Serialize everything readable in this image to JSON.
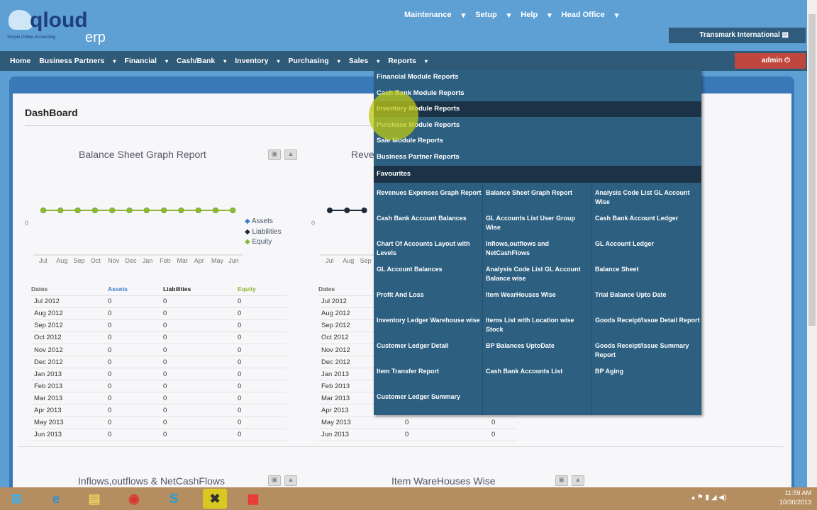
{
  "app": {
    "logo_main": "qloud",
    "logo_erp": "erp",
    "logo_tagline": "Simple Online Accounting"
  },
  "topnav": [
    "Maintenance",
    "Setup",
    "Help",
    "Head Office"
  ],
  "company": "Transmark International",
  "user": "admin",
  "mainnav": [
    "Home",
    "Business Partners",
    "Financial",
    "Cash/Bank",
    "Inventory",
    "Purchasing",
    "Sales",
    "Reports"
  ],
  "dashboard": {
    "title": "DashBoard"
  },
  "reports_menu": {
    "items": [
      "Financial Module Reports",
      "Cash Bank Module Reports",
      "Inventory Module Reports",
      "Purchase Module Reports",
      "Sale Module Reports",
      "Business Partner Reports"
    ],
    "highlighted": 2,
    "favourites_label": "Favourites",
    "favourites": [
      [
        "Revenues Expenses Graph Report",
        "Cash Bank Account Balances",
        "Chart Of Accounts Layout with Levels",
        "GL Account Balances",
        "Profit And Loss",
        "Inventory Ledger Warehouse wise",
        "Customer Ledger Detail",
        "Item Transfer Report",
        "Customer Ledger Summary"
      ],
      [
        "Balance Sheet Graph Report",
        "GL Accounts List User Group Wise",
        "Inflows,outflows and NetCashFlows",
        "Analysis Code List GL Account Balance wise",
        "Item WearHouses Wise",
        "Items List with Location wise Stock",
        "BP Balances UptoDate",
        "Cash Bank Accounts List"
      ],
      [
        "Analysis Code List GL Account Wise",
        "Cash Bank Account Ledger",
        "GL Account Ledger",
        "Balance Sheet",
        "Trial Balance Upto Date",
        "Goods Receipt/Issue Detail Report",
        "Goods Receipt/Issue Summary Report",
        "BP Aging"
      ]
    ]
  },
  "chart_data": [
    {
      "type": "line",
      "title": "Balance Sheet Graph Report",
      "categories": [
        "Jul",
        "Aug",
        "Sep",
        "Oct",
        "Nov",
        "Dec",
        "Jan",
        "Feb",
        "Mar",
        "Apr",
        "May",
        "Jun"
      ],
      "y_tick": "0",
      "ylim": [
        0,
        0
      ],
      "legend_position": "right",
      "series": [
        {
          "name": "Assets",
          "color": "#3a7fd0",
          "values": [
            0,
            0,
            0,
            0,
            0,
            0,
            0,
            0,
            0,
            0,
            0,
            0
          ]
        },
        {
          "name": "Liabilities",
          "color": "#1e2a3a",
          "values": [
            0,
            0,
            0,
            0,
            0,
            0,
            0,
            0,
            0,
            0,
            0,
            0
          ]
        },
        {
          "name": "Equity",
          "color": "#8ab833",
          "values": [
            0,
            0,
            0,
            0,
            0,
            0,
            0,
            0,
            0,
            0,
            0,
            0
          ]
        }
      ]
    },
    {
      "type": "line",
      "title": "Revenues Expenses Graph Report",
      "categories": [
        "Jul",
        "Aug",
        "Sep"
      ],
      "y_tick": "0",
      "series": [
        {
          "name": "",
          "color": "#1e2a3a",
          "values": [
            0,
            0,
            0
          ]
        }
      ]
    }
  ],
  "balance_table": {
    "headers": [
      "Dates",
      "Assets",
      "Liabilities",
      "Equity"
    ],
    "header_colors": [
      "#666",
      "#3a7fd0",
      "#222",
      "#8ab833"
    ],
    "rows": [
      [
        "Jul 2012",
        "0",
        "0",
        "0"
      ],
      [
        "Aug 2012",
        "0",
        "0",
        "0"
      ],
      [
        "Sep 2012",
        "0",
        "0",
        "0"
      ],
      [
        "Oct 2012",
        "0",
        "0",
        "0"
      ],
      [
        "Nov 2012",
        "0",
        "0",
        "0"
      ],
      [
        "Dec 2012",
        "0",
        "0",
        "0"
      ],
      [
        "Jan 2013",
        "0",
        "0",
        "0"
      ],
      [
        "Feb 2013",
        "0",
        "0",
        "0"
      ],
      [
        "Mar 2013",
        "0",
        "0",
        "0"
      ],
      [
        "Apr 2013",
        "0",
        "0",
        "0"
      ],
      [
        "May 2013",
        "0",
        "0",
        "0"
      ],
      [
        "Jun 2013",
        "0",
        "0",
        "0"
      ]
    ]
  },
  "revenue_table": {
    "headers": [
      "Dates",
      "",
      ""
    ],
    "rows": [
      [
        "Jul 2012",
        "0",
        "0"
      ],
      [
        "Aug 2012",
        "0",
        "0"
      ],
      [
        "Sep 2012",
        "0",
        "0"
      ],
      [
        "Oct 2012",
        "0",
        "0"
      ],
      [
        "Nov 2012",
        "0",
        "0"
      ],
      [
        "Dec 2012",
        "0",
        "0"
      ],
      [
        "Jan 2013",
        "0",
        "0"
      ],
      [
        "Feb 2013",
        "0",
        "0"
      ],
      [
        "Mar 2013",
        "0",
        "0"
      ],
      [
        "Apr 2013",
        "0",
        "0"
      ],
      [
        "May 2013",
        "0",
        "0"
      ],
      [
        "Jun 2013",
        "0",
        "0"
      ]
    ]
  },
  "bottom_charts": [
    "Inflows,outflows & NetCashFlows",
    "Item WareHouses Wise"
  ],
  "taskbar": {
    "time": "11:59 AM",
    "date": "10/30/2013"
  }
}
